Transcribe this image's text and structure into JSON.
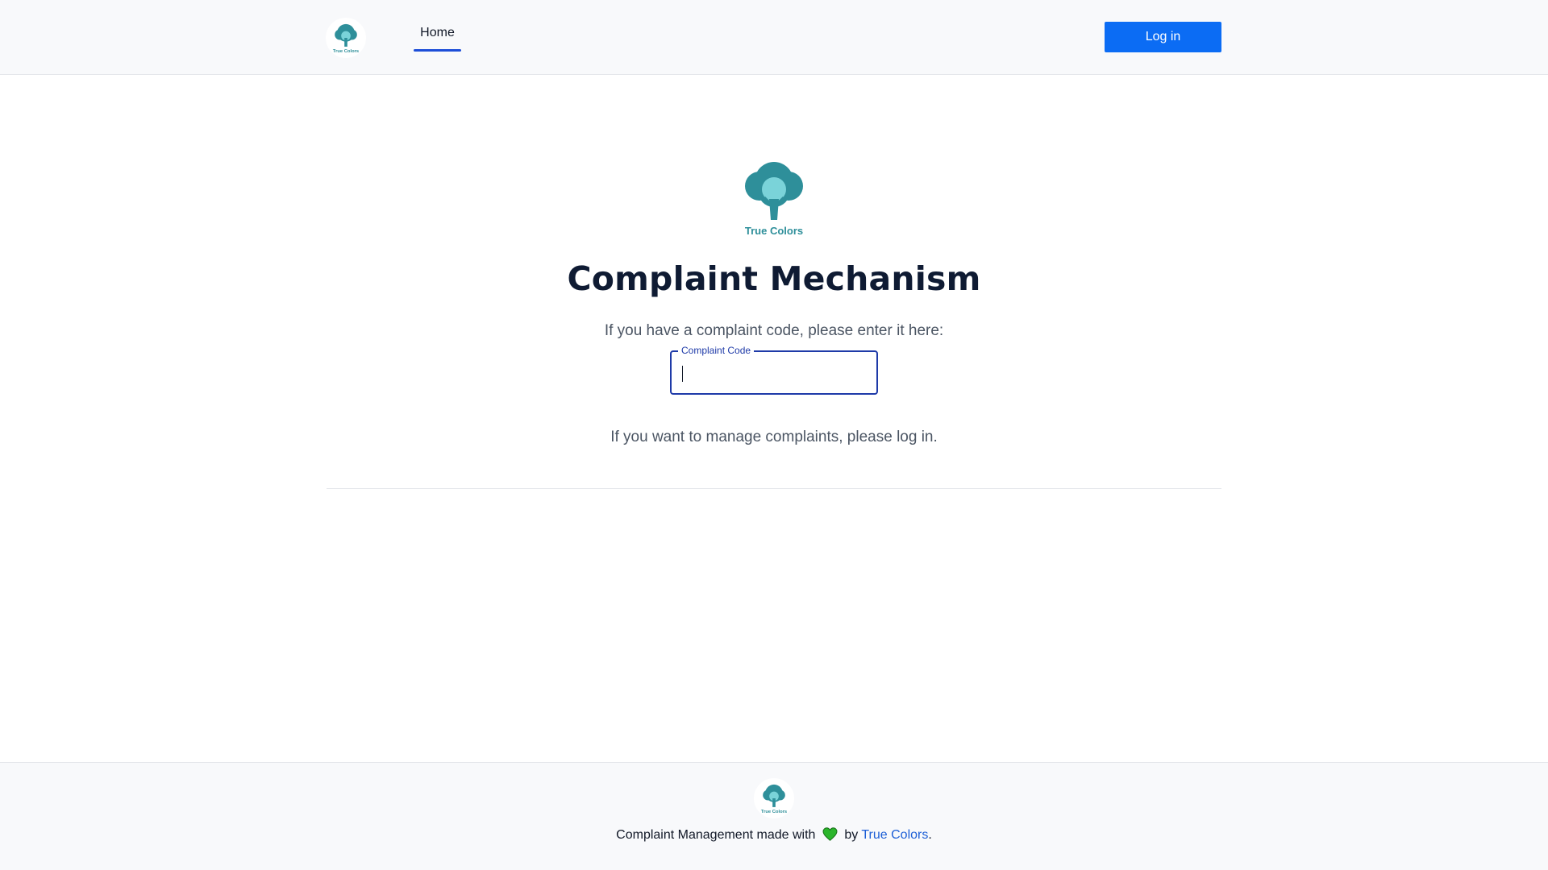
{
  "brand": {
    "name": "True Colors",
    "logo_icon": "tree-icon",
    "logo_color": "#2e8f9a",
    "logo_light": "#7ad3d9"
  },
  "header": {
    "nav_tabs": [
      {
        "label": "Home",
        "active": true
      }
    ],
    "login_label": "Log in",
    "login_color": "#0b6cf4"
  },
  "main": {
    "title": "Complaint Mechanism",
    "code_prompt": "If you have a complaint code, please enter it here:",
    "code_field": {
      "label": "Complaint Code",
      "value": "",
      "placeholder": ""
    },
    "manage_prompt": "If you want to manage complaints, please log in."
  },
  "footer": {
    "text_before": "Complaint Management made with",
    "heart_icon": "heart-icon",
    "heart_color": "#2bb52b",
    "by": "by",
    "link_label": "True Colors",
    "period": "."
  }
}
